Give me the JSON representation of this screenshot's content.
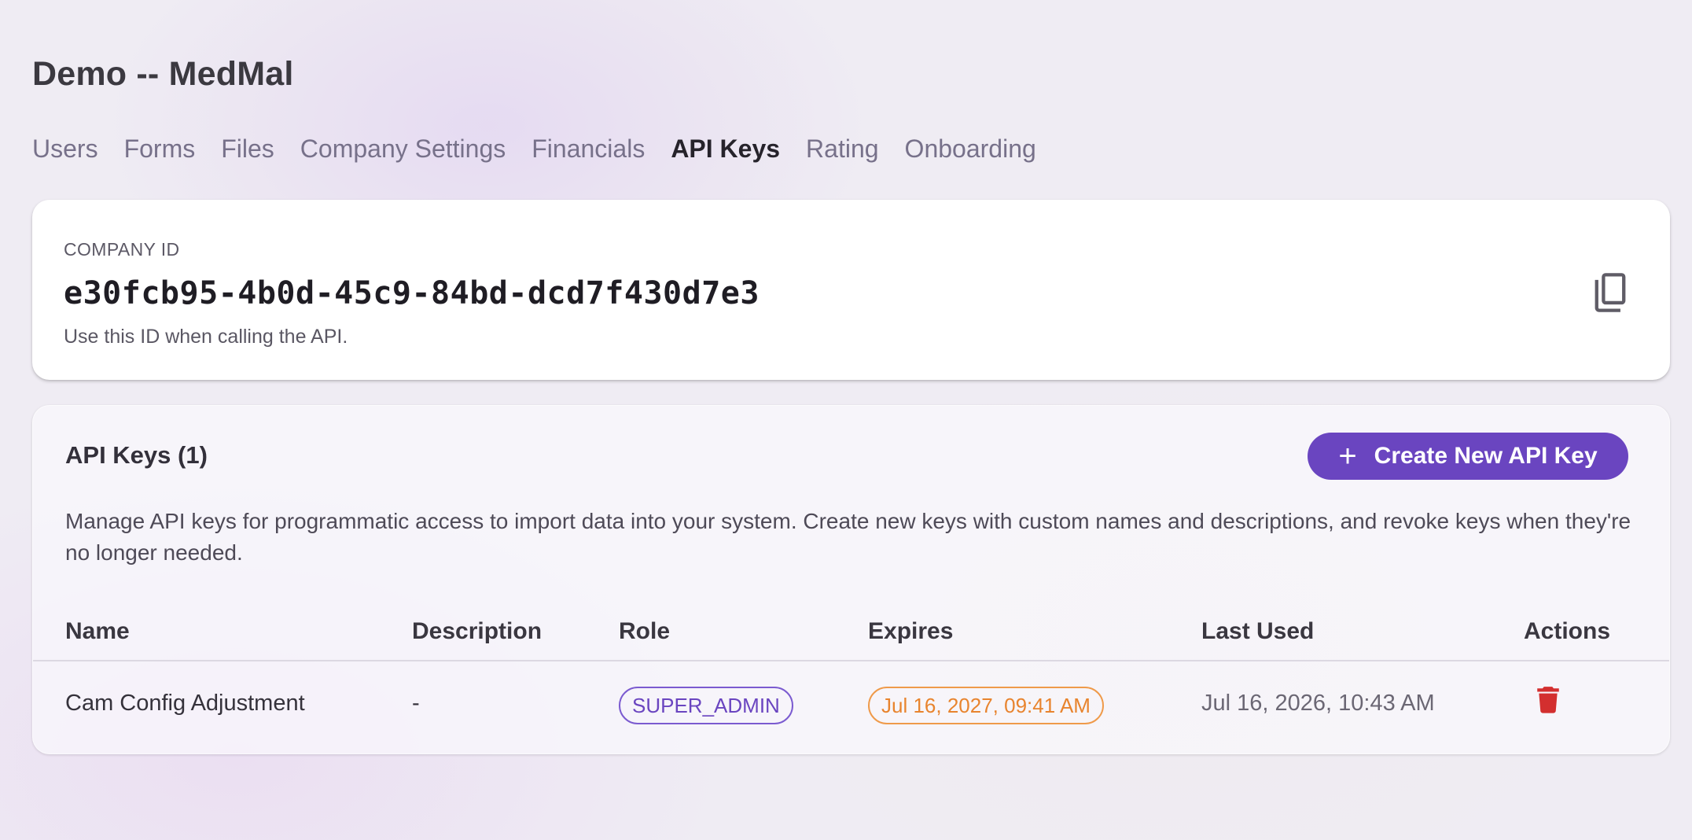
{
  "page": {
    "title": "Demo -- MedMal"
  },
  "tabs": [
    {
      "label": "Users"
    },
    {
      "label": "Forms"
    },
    {
      "label": "Files"
    },
    {
      "label": "Company Settings"
    },
    {
      "label": "Financials"
    },
    {
      "label": "API Keys",
      "active": true
    },
    {
      "label": "Rating"
    },
    {
      "label": "Onboarding"
    }
  ],
  "company": {
    "label": "COMPANY ID",
    "id": "e30fcb95-4b0d-45c9-84bd-dcd7f430d7e3",
    "help": "Use this ID when calling the API.",
    "copy_icon": "copy-icon"
  },
  "api_keys": {
    "title": "API Keys (1)",
    "create_label": "Create New API Key",
    "create_icon": "plus-icon",
    "description": "Manage API keys for programmatic access to import data into your system. Create new keys with custom names and descriptions, and revoke keys when they're no longer needed.",
    "columns": [
      "Name",
      "Description",
      "Role",
      "Expires",
      "Last Used",
      "Actions"
    ],
    "rows": [
      {
        "name": "Cam Config Adjustment",
        "description": "-",
        "role": "SUPER_ADMIN",
        "expires": "Jul 16, 2027, 09:41 AM",
        "last_used": "Jul 16, 2026, 10:43 AM",
        "action_icon": "trash-icon"
      }
    ]
  },
  "colors": {
    "accent": "#6a45c0",
    "warning": "#e8842e",
    "danger": "#d32f2f"
  }
}
